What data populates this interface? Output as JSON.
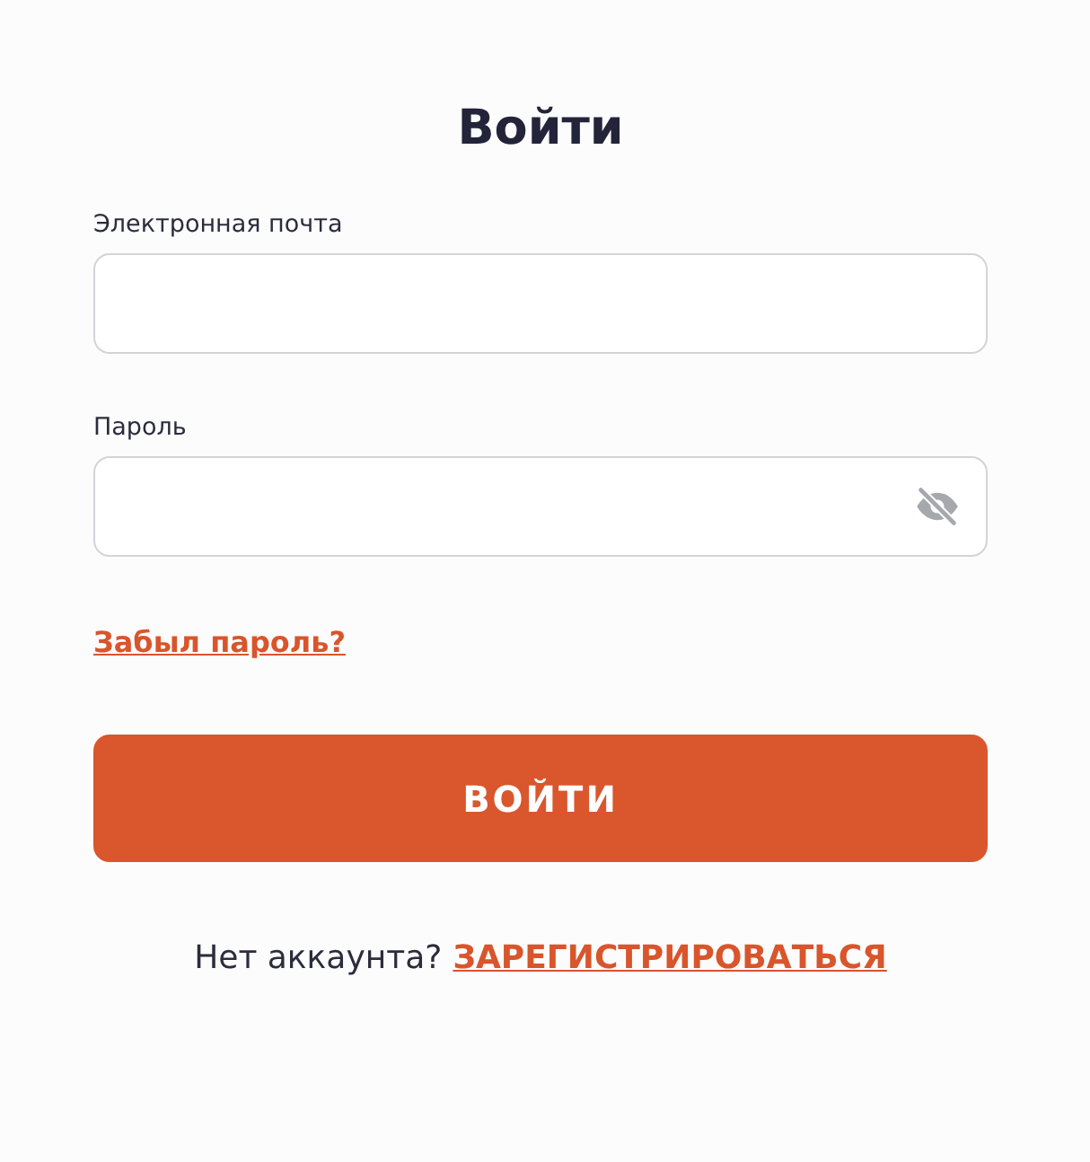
{
  "title": "Войти",
  "fields": [
    {
      "label": "Электронная почта",
      "kind": "email"
    },
    {
      "label": "Пароль",
      "kind": "password"
    }
  ],
  "forgot_link": "Забыл пароль?",
  "submit_button": "ВОЙТИ",
  "signup": {
    "prompt": "Нет аккаунта?",
    "link": "ЗАРЕГИСТРИРОВАТЬСЯ"
  }
}
